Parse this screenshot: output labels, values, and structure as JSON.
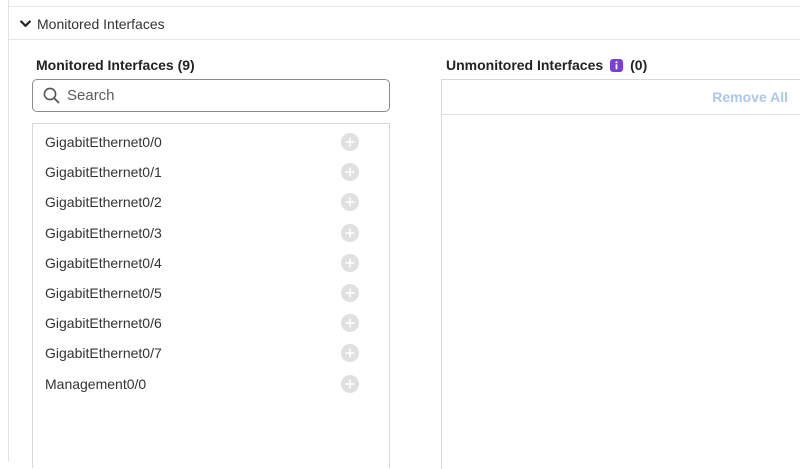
{
  "section": {
    "title": "Monitored Interfaces"
  },
  "monitored": {
    "title": "Monitored Interfaces (9)",
    "search_placeholder": "Search",
    "items": [
      "GigabitEthernet0/0",
      "GigabitEthernet0/1",
      "GigabitEthernet0/2",
      "GigabitEthernet0/3",
      "GigabitEthernet0/4",
      "GigabitEthernet0/5",
      "GigabitEthernet0/6",
      "GigabitEthernet0/7",
      "Management0/0"
    ]
  },
  "unmonitored": {
    "title": "Unmonitored Interfaces",
    "count": "(0)",
    "remove_all_label": "Remove All"
  },
  "icons": {
    "section_toggle": "chevron-down-icon",
    "search": "search-icon",
    "info": "info-icon",
    "add": "plus-circle-icon"
  },
  "colors": {
    "info_badge": "#7b3fd6",
    "remove_all_disabled": "#a9c8ee",
    "add_icon": "#e0e0e0"
  }
}
